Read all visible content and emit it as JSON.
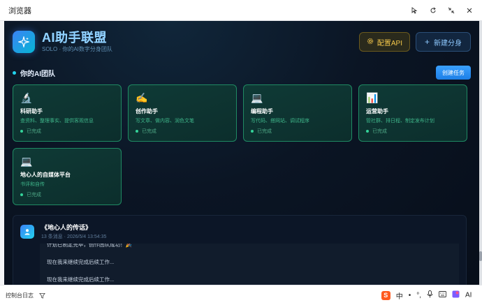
{
  "browser": {
    "title": "浏览器"
  },
  "app": {
    "brand_title": "AI助手联盟",
    "brand_subtitle": "SOLO · 你的AI数字分身团队",
    "config_api_label": "配置API",
    "new_clone_label": "新建分身"
  },
  "team": {
    "title": "你的AI团队",
    "create_task_label": "创建任务",
    "cards": [
      {
        "icon": "🔬",
        "name": "科研助手",
        "desc": "查资料、整理事实、提供客观信息",
        "status": "已完成"
      },
      {
        "icon": "✍️",
        "name": "创作助手",
        "desc": "写文章、做内容、润色文笔",
        "status": "已完成"
      },
      {
        "icon": "💻",
        "name": "编程助手",
        "desc": "写代码、搭网站、调试程序",
        "status": "已完成"
      },
      {
        "icon": "📊",
        "name": "运营助手",
        "desc": "管社群、排日程、制定发布计划",
        "status": "已完成"
      },
      {
        "icon": "💻",
        "name": "地心人的自媒体平台",
        "desc": "书评和自传",
        "status": "已完成"
      }
    ]
  },
  "chat": {
    "title": "《地心人的传话》",
    "subtitle": "13 条消息 · 2026/5/4 13:54:35",
    "messages": [
      "计划已制定完毕，创作团队成功！🎉",
      "现在我来继续完成后续工作...",
      "现在我来继续完成后续工作..."
    ]
  },
  "bottom": {
    "console_log_label": "控制台日志",
    "ime": [
      "中",
      "•",
      "°,"
    ]
  },
  "colors": {
    "accent": "#22d3ee",
    "card_border": "#1f8a63",
    "status_done": "#34d399",
    "api_button": "#f3c64a"
  }
}
